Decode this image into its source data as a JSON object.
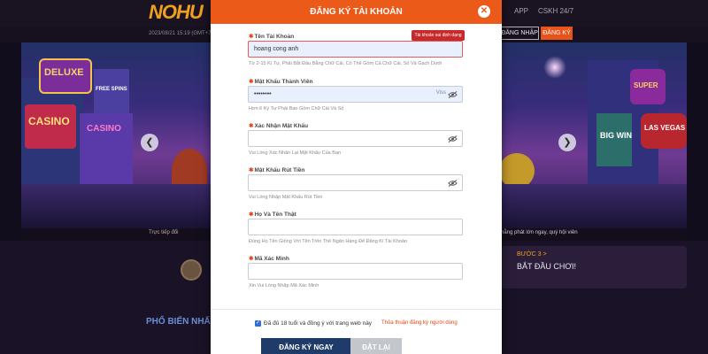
{
  "background": {
    "logo": "NOHU",
    "nav": {
      "app": "APP",
      "support": "CSKH 24/7"
    },
    "date_text": "2023/08/21 15:19 (GMT+7)",
    "login_button": "ĐĂNG NHẬP",
    "register_button": "ĐĂNG KÝ",
    "ticker_left": "Trực tiếp đổi",
    "ticker_right": "hằng phát lớn ngay, quý hội viên",
    "step_label": "BƯỚC 3 >",
    "step_title": "BẮT ĐẦU CHƠI!",
    "popular_heading": "PHỔ BIẾN NHẤT",
    "banner_signs": [
      "DELUXE",
      "FREE SPINS",
      "CASINO",
      "CASINO",
      "SUPER",
      "BIG WIN",
      "LAS VEGAS"
    ]
  },
  "modal": {
    "title": "ĐĂNG KÝ TÀI KHOẢN",
    "fields": [
      {
        "label": "Tên Tài Khoản",
        "value": "hoang cong anh",
        "hint": "Từ 2-15 Kí Tự, Phải Bắt Đầu Bằng Chữ Cái, Có Thể Gồm Cả Chữ Cái, Số Và Gạch Dưới",
        "error": "Tài khoản sai định dạng"
      },
      {
        "label": "Mật Khẩu Thành Viên",
        "value": "••••••••",
        "hint": "Hơn 6 Ký Tự Phải Bao Gồm Chữ Cái Và Số",
        "saved": "Viss"
      },
      {
        "label": "Xác Nhận Mật Khẩu",
        "value": "",
        "hint": "Vui Lòng Xác Nhận Lại Mật Khẩu Của Bạn"
      },
      {
        "label": "Mật Khẩu Rút Tiền",
        "value": "",
        "hint": "Vui Lòng Nhập Mật Khẩu Rút Tiền"
      },
      {
        "label": "Họ Và Tên Thật",
        "value": "",
        "hint": "Đúng Họ Tên Giống Với Tên Trên Thẻ Ngân Hàng Để Đăng Kí Tài Khoản"
      },
      {
        "label": "Mã Xác Minh",
        "value": "",
        "hint": "Xin Vui Lòng Nhập Mã Xác Minh"
      }
    ],
    "agree_text": "Đã đủ 18 tuổi và đồng ý với trang web này",
    "policy_link": "Thỏa thuận đăng ký người dùng",
    "submit_button": "ĐĂNG KÝ NGAY",
    "reset_button": "ĐẶT LẠI"
  },
  "icons": {
    "close": "close-icon",
    "eye": "eye-slash-icon",
    "arrows": [
      "chevron-left-icon",
      "chevron-right-icon"
    ]
  },
  "colors": {
    "accent": "#ec5a1a",
    "submit": "#1f3b6a",
    "error": "#c72a2a",
    "link": "#e0481a"
  }
}
